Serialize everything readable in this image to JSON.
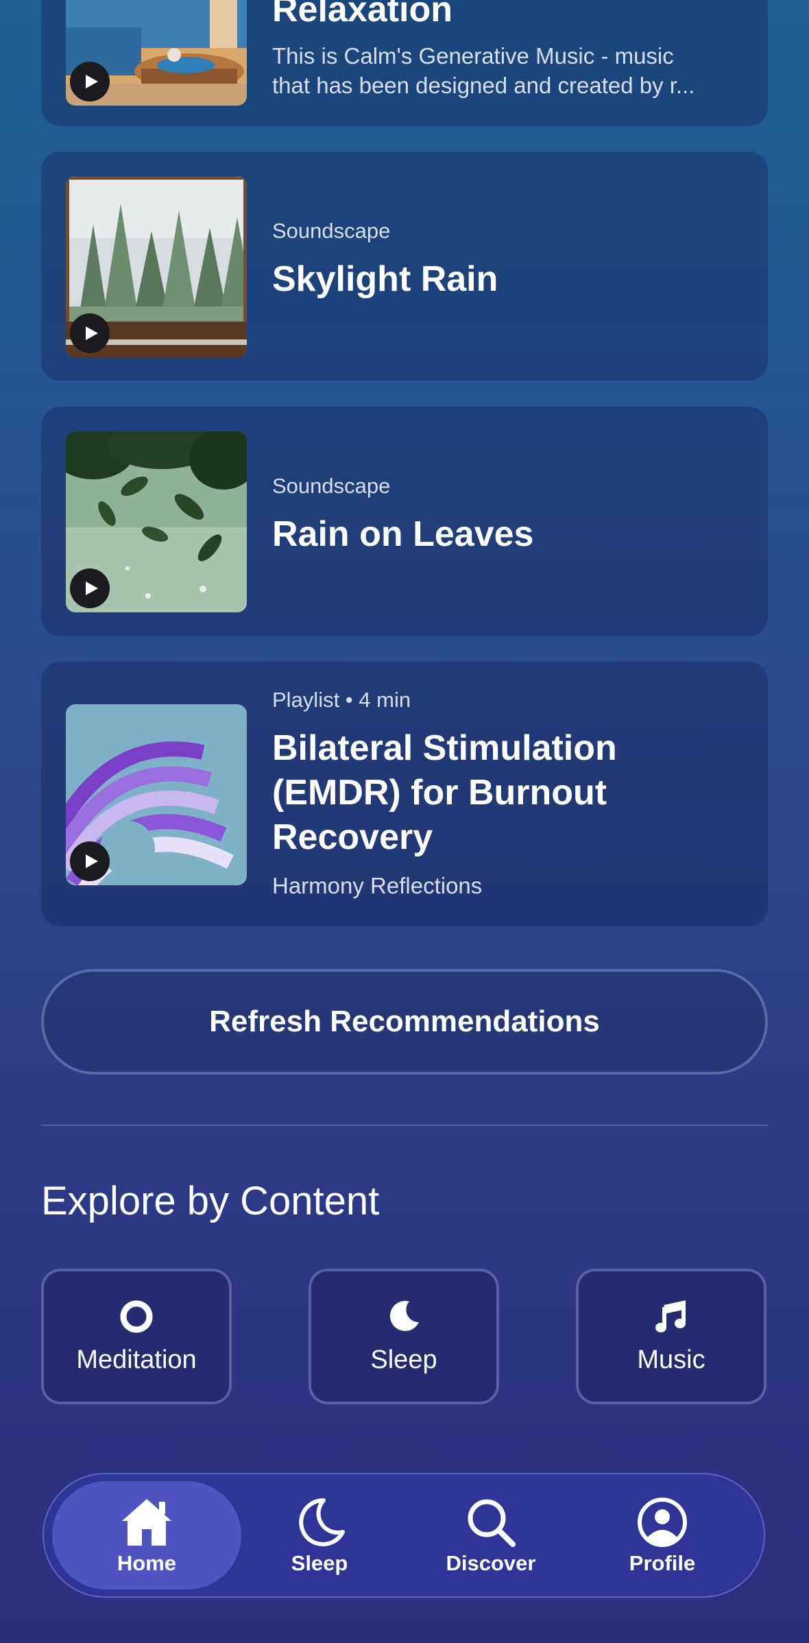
{
  "cards": [
    {
      "title": "Relaxation",
      "description_lines": [
        "This is Calm's Generative Music - music",
        "that has been designed and created by r..."
      ]
    },
    {
      "type": "Soundscape",
      "title": "Skylight Rain"
    },
    {
      "type": "Soundscape",
      "title": "Rain on Leaves"
    },
    {
      "type": "Playlist • 4 min",
      "title_lines": [
        "Bilateral Stimulation",
        "(EMDR) for Burnout",
        "Recovery"
      ],
      "author": "Harmony Reflections"
    }
  ],
  "refresh_label": "Refresh Recommendations",
  "explore": {
    "title": "Explore by Content",
    "tiles": [
      {
        "label": "Meditation",
        "icon": "circle-icon"
      },
      {
        "label": "Sleep",
        "icon": "moon-icon"
      },
      {
        "label": "Music",
        "icon": "music-note-icon"
      }
    ]
  },
  "nav": {
    "items": [
      {
        "label": "Home",
        "icon": "home-icon",
        "active": true
      },
      {
        "label": "Sleep",
        "icon": "moon-icon",
        "active": false
      },
      {
        "label": "Discover",
        "icon": "search-icon",
        "active": false
      },
      {
        "label": "Profile",
        "icon": "profile-icon",
        "active": false
      }
    ]
  },
  "colors": {
    "background_top": "#1e5f95",
    "background_bottom": "#2b2f80",
    "nav_background": "#2e3596",
    "nav_active": "#4f54c0"
  }
}
